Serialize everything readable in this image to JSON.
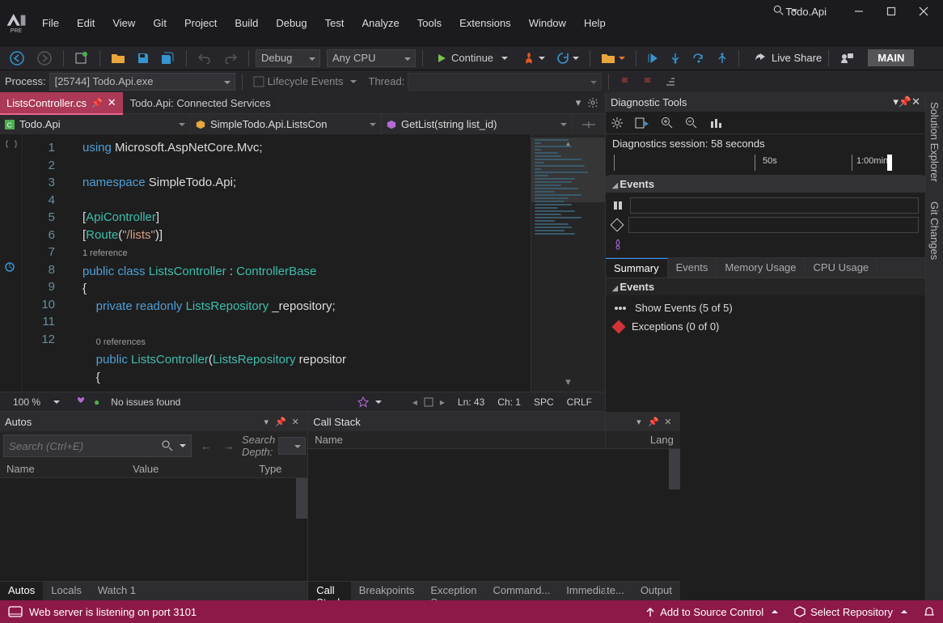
{
  "app": {
    "title": "Todo.Api"
  },
  "menu": [
    "File",
    "Edit",
    "View",
    "Git",
    "Project",
    "Build",
    "Debug",
    "Test",
    "Analyze",
    "Tools",
    "Extensions",
    "Window",
    "Help"
  ],
  "toolbar1": {
    "config": "Debug",
    "platform": "Any CPU",
    "continue": "Continue",
    "live_share": "Live Share",
    "main_btn": "MAIN"
  },
  "toolbar2": {
    "process_label": "Process:",
    "process_value": "[25744] Todo.Api.exe",
    "lifecycle": "Lifecycle Events",
    "thread": "Thread:"
  },
  "doc_tabs": {
    "active": "ListsController.cs",
    "second": "Todo.Api: Connected Services"
  },
  "nav": {
    "project": "Todo.Api",
    "class": "SimpleTodo.Api.ListsCon",
    "member": "GetList(string list_id)"
  },
  "code": {
    "line_start": 1,
    "lines": [
      {
        "n": 1,
        "html": "<span class='kw'>using</span> <span class='pl'>Microsoft.AspNetCore.Mvc;</span>"
      },
      {
        "n": 2,
        "html": ""
      },
      {
        "n": 3,
        "html": "<span class='kw'>namespace</span> <span class='pl'>SimpleTodo.Api;</span>"
      },
      {
        "n": 4,
        "html": ""
      },
      {
        "n": 5,
        "html": "<span class='pl'>[</span><span class='att'>ApiController</span><span class='pl'>]</span>"
      },
      {
        "n": 6,
        "html": "<span class='pl'>[</span><span class='att'>Route</span><span class='pl'>(</span><span class='str'>\"/lists\"</span><span class='pl'>)]</span>"
      },
      {
        "n": "",
        "html": "<span class='fade'>1 reference</span>"
      },
      {
        "n": 7,
        "html": "<span class='kw'>public</span> <span class='kw'>class</span> <span class='ty'>ListsController</span> <span class='pl'>:</span> <span class='ty'>ControllerBase</span>"
      },
      {
        "n": 8,
        "html": "<span class='pl'>{</span>"
      },
      {
        "n": 9,
        "html": "    <span class='kw'>private</span> <span class='kw'>readonly</span> <span class='ty'>ListsRepository</span> <span class='pl'>_repository;</span>"
      },
      {
        "n": 10,
        "html": ""
      },
      {
        "n": "",
        "html": "    <span class='fade'>0 references</span>"
      },
      {
        "n": 11,
        "html": "    <span class='kw'>public</span> <span class='ty'>ListsController</span><span class='pl'>(</span><span class='ty'>ListsRepository</span> <span class='pl'>repositor</span>"
      },
      {
        "n": 12,
        "html": "    <span class='pl'>{</span>"
      }
    ]
  },
  "editor_status": {
    "zoom": "100 %",
    "issues": "No issues found",
    "ln": "Ln: 43",
    "ch": "Ch: 1",
    "spc": "SPC",
    "crlf": "CRLF"
  },
  "autos": {
    "title": "Autos",
    "search_ph": "Search (Ctrl+E)",
    "depth": "Search Depth:",
    "cols": [
      "Name",
      "Value",
      "Type"
    ],
    "tabs": [
      "Autos",
      "Locals",
      "Watch 1"
    ]
  },
  "callstack": {
    "title": "Call Stack",
    "cols": [
      "Name",
      "Lang"
    ],
    "tabs": [
      "Call Stack",
      "Breakpoints",
      "Exception Se...",
      "Command...",
      "Immediate...",
      "Output"
    ]
  },
  "diag": {
    "title": "Diagnostic Tools",
    "session": "Diagnostics session: 58 seconds",
    "timeline": {
      "t1": "50s",
      "t2": "1:00min"
    },
    "events_h": "Events",
    "summary_tabs": [
      "Summary",
      "Events",
      "Memory Usage",
      "CPU Usage"
    ],
    "events_title": "Events",
    "show_events": "Show Events (5 of 5)",
    "exceptions": "Exceptions (0 of 0)"
  },
  "side_tabs": [
    "Solution Explorer",
    "Git Changes"
  ],
  "statusbar": {
    "msg": "Web server is listening on port 3101",
    "source_control": "Add to Source Control",
    "select_repo": "Select Repository"
  }
}
